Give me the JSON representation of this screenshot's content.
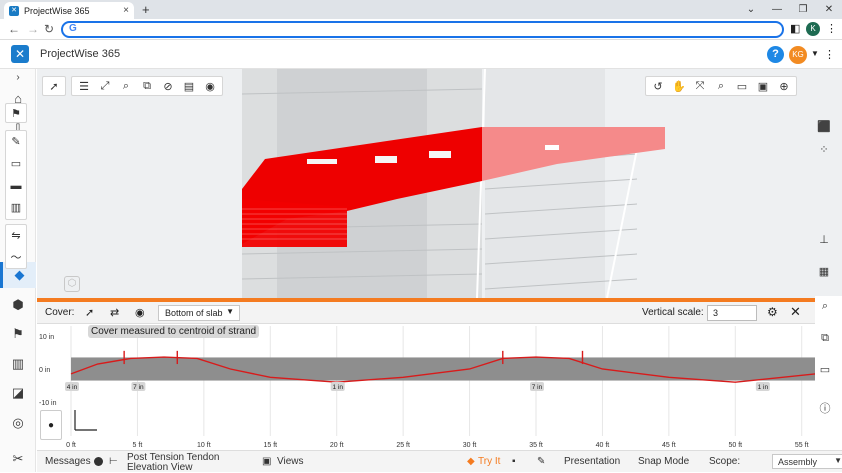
{
  "browser": {
    "tab_title": "ProjectWise 365",
    "tab_close": "×",
    "new_tab": "+",
    "omnibox_badge": "G",
    "profile_initial": "K"
  },
  "app": {
    "title": "ProjectWise 365",
    "help": "?",
    "user_initials": "KG"
  },
  "panel": {
    "cover_label": "Cover:",
    "cover_select": "Bottom of slab",
    "vertical_scale_label": "Vertical scale:",
    "vertical_scale_value": "3",
    "callout": "Cover measured to centroid of strand"
  },
  "chart_data": {
    "type": "line",
    "xlabel": "",
    "ylabel": "",
    "x_ticks": [
      "0 ft",
      "5 ft",
      "10 ft",
      "15 ft",
      "20 ft",
      "25 ft",
      "30 ft",
      "35 ft",
      "40 ft",
      "45 ft",
      "50 ft",
      "55 ft"
    ],
    "y_ticks": [
      "10 in",
      "0 in",
      "-10 in"
    ],
    "ylim": [
      -10,
      10
    ],
    "xlim": [
      0,
      56
    ],
    "series": [
      {
        "x": [
          0,
          2,
          4.5,
          7,
          9.5,
          12,
          15,
          20,
          25,
          30,
          32.5,
          35,
          37.5,
          40,
          45,
          50,
          56
        ],
        "y": [
          -1.5,
          1.5,
          3.2,
          3.6,
          3.2,
          0,
          -2.5,
          -4,
          -2.5,
          0,
          3.2,
          3.6,
          3.2,
          0,
          -2.5,
          -4,
          -1.5
        ]
      }
    ],
    "cover_labels": [
      {
        "x": 0,
        "text": "4 in"
      },
      {
        "x": 5,
        "text": "7 in"
      },
      {
        "x": 20,
        "text": "1 in"
      },
      {
        "x": 35,
        "text": "7 in"
      },
      {
        "x": 52,
        "text": "1 in"
      }
    ],
    "ticks_at": [
      4,
      8,
      32.5,
      38.5
    ],
    "band_color": "#8e8e8e",
    "line_color": "#d81b1b"
  },
  "status": {
    "messages": "Messages",
    "view_name": "Post Tension Tendon Elevation View",
    "views": "Views",
    "try_it": "Try It",
    "presentation": "Presentation",
    "snap_mode": "Snap Mode",
    "scope_label": "Scope:",
    "scope_value": "Assembly"
  }
}
